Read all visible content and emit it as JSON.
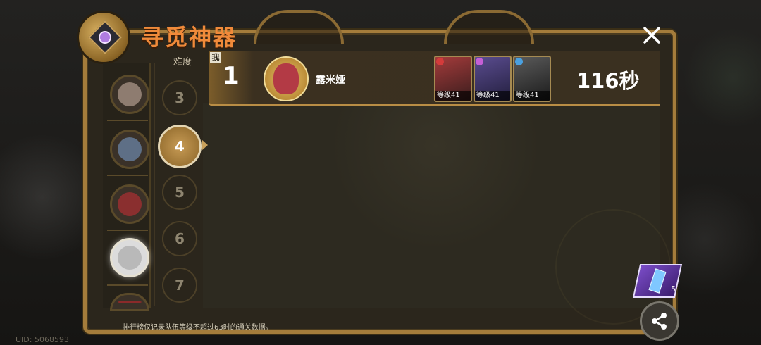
{
  "header": {
    "title": "寻觅神器",
    "close_icon": "close-icon"
  },
  "difficulty": {
    "label": "难度",
    "levels": [
      "3",
      "4",
      "5",
      "6",
      "7"
    ],
    "selected": "4"
  },
  "bosses": [
    {
      "icon": "boss-portrait-icon",
      "color": "#8e7c70"
    },
    {
      "icon": "boss-portrait-icon",
      "color": "#5e6f86"
    },
    {
      "icon": "boss-portrait-icon",
      "color": "#8a2f2f"
    },
    {
      "icon": "boss-portrait-icon",
      "color": "#cfcfcf",
      "selected": true
    },
    {
      "icon": "boss-portrait-icon",
      "color": "#8b2a2a"
    }
  ],
  "leaderboard": {
    "me_tag": "我",
    "entries": [
      {
        "rank": "1",
        "name": "露米娅",
        "time": "116秒",
        "heroes": [
          {
            "level": "等级41",
            "color": "#7a2d2d"
          },
          {
            "level": "等级41",
            "color": "#3d3c6e"
          },
          {
            "level": "等级41",
            "color": "#2e2e2e"
          }
        ]
      }
    ]
  },
  "footer": {
    "note": "排行榜仅记录队伍等级不超过63时的通关数据。"
  },
  "item": {
    "count": "5",
    "icon": "crystal-icon"
  },
  "share_icon": "share-icon",
  "uid_text": "UID: 5068593"
}
